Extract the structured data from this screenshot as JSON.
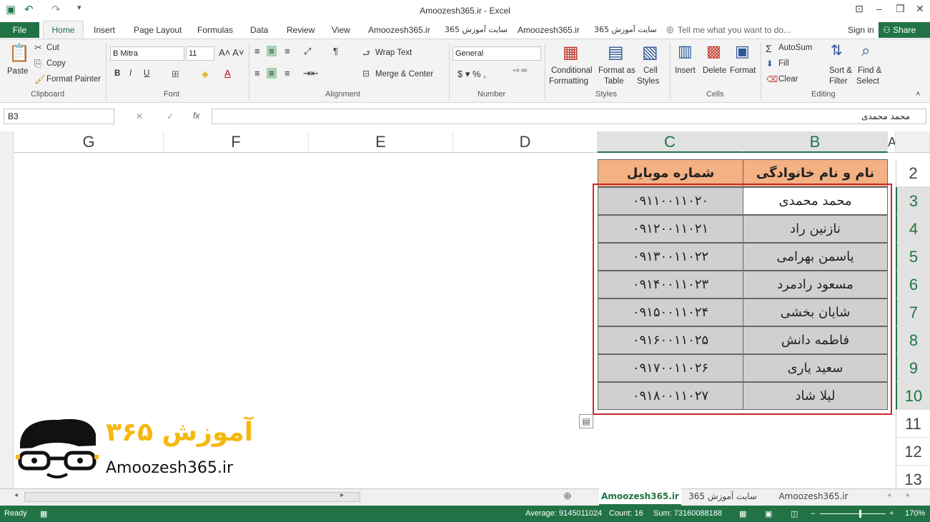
{
  "window": {
    "title": "Amoozesh365.ir - Excel"
  },
  "ribbon_tabs": [
    "File",
    "Home",
    "Insert",
    "Page Layout",
    "Formulas",
    "Data",
    "Review",
    "View",
    "Amoozesh365.ir",
    "سایت آموزش 365",
    "Amoozesh365.ir",
    "سایت آموزش 365"
  ],
  "tell_me": "Tell me what you want to do...",
  "sign_in": "Sign in",
  "share": "Share",
  "clipboard": {
    "paste": "Paste",
    "cut": "Cut",
    "copy": "Copy",
    "format_painter": "Format Painter",
    "group": "Clipboard"
  },
  "font": {
    "name": "B Mitra",
    "size": "11",
    "group": "Font"
  },
  "alignment": {
    "wrap": "Wrap Text",
    "merge": "Merge & Center",
    "group": "Alignment"
  },
  "number": {
    "format": "General",
    "group": "Number"
  },
  "styles": {
    "cond": "Conditional",
    "cond2": "Formatting",
    "fmt_table": "Format as",
    "fmt_table2": "Table",
    "cell": "Cell",
    "cell2": "Styles",
    "group": "Styles"
  },
  "cells": {
    "insert": "Insert",
    "delete": "Delete",
    "format": "Format",
    "group": "Cells"
  },
  "editing": {
    "autosum": "AutoSum",
    "fill": "Fill",
    "clear": "Clear",
    "sort": "Sort &",
    "sort2": "Filter",
    "find": "Find &",
    "find2": "Select",
    "group": "Editing"
  },
  "formula_bar": {
    "name_box": "B3",
    "value": "محمد محمدی"
  },
  "columns": [
    "G",
    "F",
    "E",
    "D",
    "C",
    "B",
    "A"
  ],
  "rows": [
    "2",
    "3",
    "4",
    "5",
    "6",
    "7",
    "8",
    "9",
    "10",
    "11",
    "12",
    "13"
  ],
  "table": {
    "header_b": "نام و نام خانوادگی",
    "header_c": "شماره موبایل",
    "data": [
      {
        "name": "محمد محمدی",
        "phone": "۰۹۱۱۰۰۱۱۰۲۰"
      },
      {
        "name": "نازنین راد",
        "phone": "۰۹۱۲۰۰۱۱۰۲۱"
      },
      {
        "name": "یاسمن بهرامی",
        "phone": "۰۹۱۳۰۰۱۱۰۲۲"
      },
      {
        "name": "مسعود رادمرد",
        "phone": "۰۹۱۴۰۰۱۱۰۲۳"
      },
      {
        "name": "شایان بخشی",
        "phone": "۰۹۱۵۰۰۱۱۰۲۴"
      },
      {
        "name": "فاطمه دانش",
        "phone": "۰۹۱۶۰۰۱۱۰۲۵"
      },
      {
        "name": "سعید یاری",
        "phone": "۰۹۱۷۰۰۱۱۰۲۶"
      },
      {
        "name": "لیلا شاد",
        "phone": "۰۹۱۸۰۰۱۱۰۲۷"
      }
    ]
  },
  "logo": {
    "persian": "آموزش ۳۶۵",
    "latin": "Amoozesh365.ir"
  },
  "sheet_tabs": [
    "Amoozesh365.ir",
    "سایت آموزش 365",
    "Amoozesh365.ir"
  ],
  "status": {
    "ready": "Ready",
    "average": "Average: 9145011024",
    "count": "Count: 16",
    "sum": "Sum: 73160088188",
    "zoom": "170%"
  }
}
